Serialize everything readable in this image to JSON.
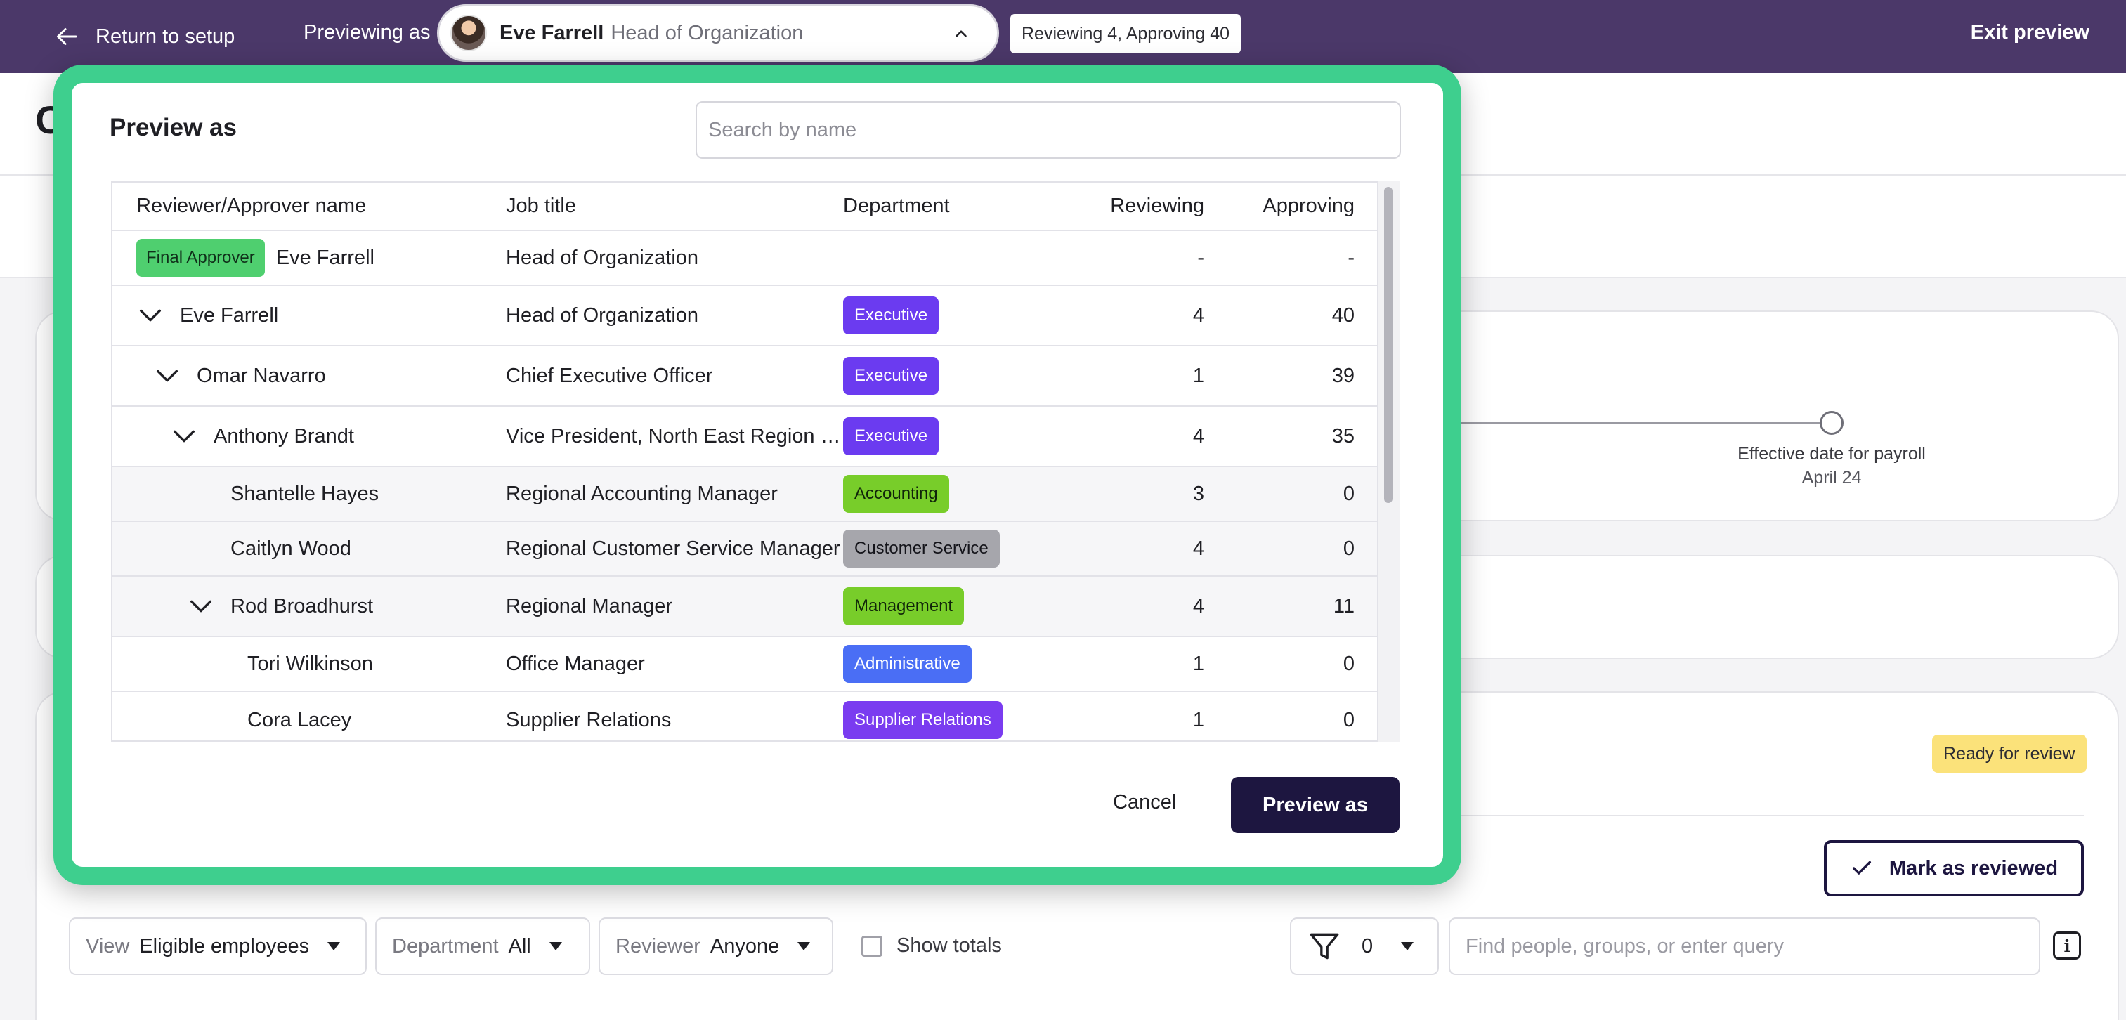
{
  "topbar": {
    "return_label": "Return to setup",
    "previewing_as_label": "Previewing as",
    "selected_user": {
      "name": "Eve Farrell",
      "title": "Head of Organization"
    },
    "counts_badge": "Reviewing 4, Approving 40",
    "exit_label": "Exit preview"
  },
  "background": {
    "page_letter": "C",
    "timeline": {
      "label": "Effective date for payroll",
      "date": "April 24"
    },
    "status_badge": "Ready for review",
    "mark_reviewed_label": "Mark as reviewed",
    "filters": {
      "view": {
        "label": "View",
        "value": "Eligible employees"
      },
      "department": {
        "label": "Department",
        "value": "All"
      },
      "reviewer": {
        "label": "Reviewer",
        "value": "Anyone"
      },
      "show_totals_label": "Show totals",
      "filter_count": "0",
      "query_placeholder": "Find people, groups, or enter query"
    }
  },
  "modal": {
    "title": "Preview as",
    "search_placeholder": "Search by name",
    "columns": [
      "Reviewer/Approver name",
      "Job title",
      "Department",
      "Reviewing",
      "Approving"
    ],
    "final_approver": {
      "badge": "Final Approver",
      "name": "Eve Farrell",
      "job": "Head of Organization",
      "reviewing": "-",
      "approving": "-"
    },
    "rows": [
      {
        "name": "Eve Farrell",
        "job": "Head of Organization",
        "dept": "Executive",
        "reviewing": "4",
        "approving": "40"
      },
      {
        "name": "Omar Navarro",
        "job": "Chief Executive Officer",
        "dept": "Executive",
        "reviewing": "1",
        "approving": "39"
      },
      {
        "name": "Anthony Brandt",
        "job": "Vice President, North East Region & Operations",
        "dept": "Executive",
        "reviewing": "4",
        "approving": "35"
      },
      {
        "name": "Shantelle Hayes",
        "job": "Regional Accounting Manager",
        "dept": "Accounting",
        "reviewing": "3",
        "approving": "0"
      },
      {
        "name": "Caitlyn Wood",
        "job": "Regional Customer Service Manager",
        "dept": "Customer Service",
        "reviewing": "4",
        "approving": "0"
      },
      {
        "name": "Rod Broadhurst",
        "job": "Regional Manager",
        "dept": "Management",
        "reviewing": "4",
        "approving": "11"
      },
      {
        "name": "Tori Wilkinson",
        "job": "Office Manager",
        "dept": "Administrative",
        "reviewing": "1",
        "approving": "0"
      },
      {
        "name": "Cora Lacey",
        "job": "Supplier Relations",
        "dept": "Supplier Relations",
        "reviewing": "1",
        "approving": "0"
      }
    ],
    "cancel_label": "Cancel",
    "preview_button_label": "Preview as"
  },
  "colors": {
    "topbar": "#4b3869",
    "modal_highlight": "#3ecf8e",
    "primary_button": "#1d1640",
    "final_approver_badge": "#4fcf6f",
    "dept_executive": "#6b3bf0",
    "dept_accounting": "#78cd2a",
    "dept_customer_service": "#a6a6ac",
    "dept_management": "#78cd2a",
    "dept_administrative": "#4a6ef5",
    "dept_supplier_relations": "#7a3cf0",
    "ready_badge": "#fbe27a"
  },
  "icons": {
    "return": "arrow-left-icon",
    "select_toggle": "chevron-up-icon",
    "row_expand": "chevron-down-icon",
    "mark_reviewed": "check-icon",
    "filter": "funnel-icon",
    "dropdown": "caret-down-icon",
    "info": "info-icon"
  }
}
